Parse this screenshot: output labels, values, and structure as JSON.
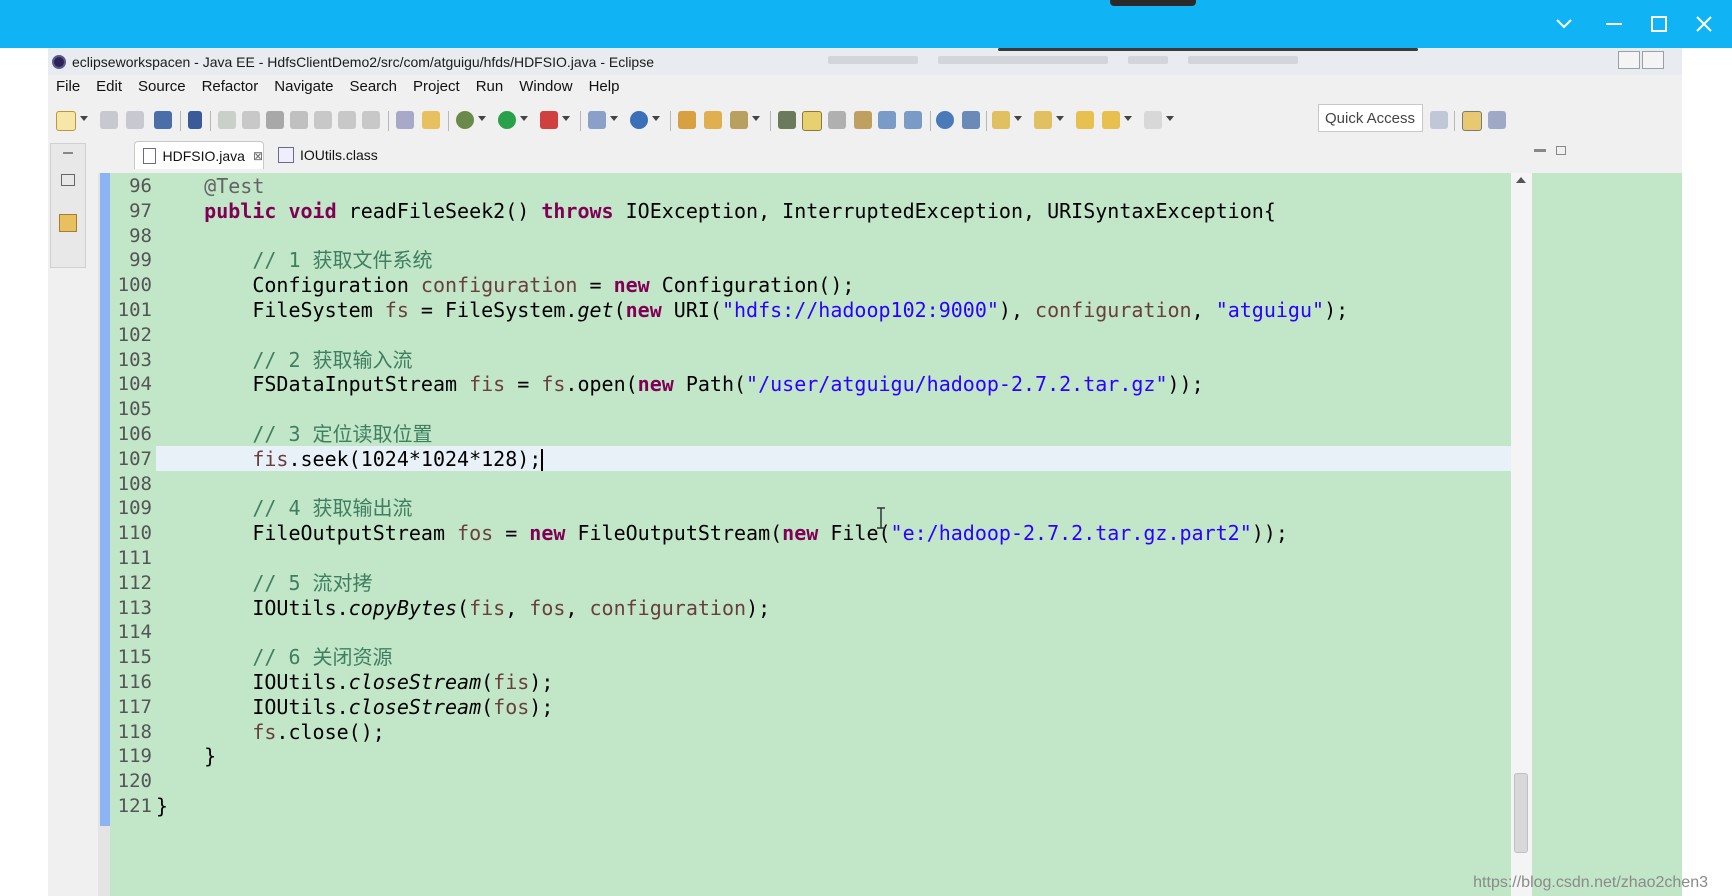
{
  "outer": {
    "title_bar_color": "#10b4f4"
  },
  "window": {
    "title": "eclipseworkspacen - Java EE - HdfsClientDemo2/src/com/atguigu/hfds/HDFSIO.java - Eclipse"
  },
  "menu": [
    "File",
    "Edit",
    "Source",
    "Refactor",
    "Navigate",
    "Search",
    "Project",
    "Run",
    "Window",
    "Help"
  ],
  "quick_access": "Quick Access",
  "tabs": [
    {
      "label": "HDFSIO.java",
      "active": true
    },
    {
      "label": "IOUtils.class",
      "active": false
    }
  ],
  "editor": {
    "lines": [
      {
        "n": "96",
        "code": [
          {
            "t": "    "
          },
          {
            "t": "@Test",
            "c": "ann"
          }
        ]
      },
      {
        "n": "97",
        "code": [
          {
            "t": "    "
          },
          {
            "t": "public",
            "c": "kw"
          },
          {
            "t": " "
          },
          {
            "t": "void",
            "c": "kw"
          },
          {
            "t": " readFileSeek2() "
          },
          {
            "t": "throws",
            "c": "kw"
          },
          {
            "t": " IOException, InterruptedException, URISyntaxException{"
          }
        ]
      },
      {
        "n": "98",
        "code": []
      },
      {
        "n": "99",
        "code": [
          {
            "t": "        "
          },
          {
            "t": "// 1 获取文件系统",
            "c": "cm"
          }
        ]
      },
      {
        "n": "100",
        "code": [
          {
            "t": "        Configuration "
          },
          {
            "t": "configuration",
            "c": "var"
          },
          {
            "t": " = "
          },
          {
            "t": "new",
            "c": "kw"
          },
          {
            "t": " Configuration();"
          }
        ]
      },
      {
        "n": "101",
        "code": [
          {
            "t": "        FileSystem "
          },
          {
            "t": "fs",
            "c": "var"
          },
          {
            "t": " = FileSystem."
          },
          {
            "t": "get",
            "c": "st"
          },
          {
            "t": "("
          },
          {
            "t": "new",
            "c": "kw"
          },
          {
            "t": " URI("
          },
          {
            "t": "\"hdfs://hadoop102:9000\"",
            "c": "str"
          },
          {
            "t": "), "
          },
          {
            "t": "configuration",
            "c": "var"
          },
          {
            "t": ", "
          },
          {
            "t": "\"atguigu\"",
            "c": "str"
          },
          {
            "t": ");"
          }
        ]
      },
      {
        "n": "102",
        "code": []
      },
      {
        "n": "103",
        "code": [
          {
            "t": "        "
          },
          {
            "t": "// 2 获取输入流",
            "c": "cm"
          }
        ]
      },
      {
        "n": "104",
        "code": [
          {
            "t": "        FSDataInputStream "
          },
          {
            "t": "fis",
            "c": "var"
          },
          {
            "t": " = "
          },
          {
            "t": "fs",
            "c": "var"
          },
          {
            "t": ".open("
          },
          {
            "t": "new",
            "c": "kw"
          },
          {
            "t": " Path("
          },
          {
            "t": "\"/user/atguigu/hadoop-2.7.2.tar.gz\"",
            "c": "str"
          },
          {
            "t": "));"
          }
        ]
      },
      {
        "n": "105",
        "code": []
      },
      {
        "n": "106",
        "code": [
          {
            "t": "        "
          },
          {
            "t": "// 3 定位读取位置",
            "c": "cm"
          }
        ]
      },
      {
        "n": "107",
        "code": [
          {
            "t": "        "
          },
          {
            "t": "fis",
            "c": "var"
          },
          {
            "t": ".seek(1024*1024*128);"
          }
        ],
        "current": true
      },
      {
        "n": "108",
        "code": []
      },
      {
        "n": "109",
        "code": [
          {
            "t": "        "
          },
          {
            "t": "// 4 获取输出流",
            "c": "cm"
          }
        ]
      },
      {
        "n": "110",
        "code": [
          {
            "t": "        FileOutputStream "
          },
          {
            "t": "fos",
            "c": "var"
          },
          {
            "t": " = "
          },
          {
            "t": "new",
            "c": "kw"
          },
          {
            "t": " FileOutputStream("
          },
          {
            "t": "new",
            "c": "kw"
          },
          {
            "t": " File("
          },
          {
            "t": "\"e:/hadoop-2.7.2.tar.gz.part2\"",
            "c": "str"
          },
          {
            "t": "));"
          }
        ]
      },
      {
        "n": "111",
        "code": []
      },
      {
        "n": "112",
        "code": [
          {
            "t": "        "
          },
          {
            "t": "// 5 流对拷",
            "c": "cm"
          }
        ]
      },
      {
        "n": "113",
        "code": [
          {
            "t": "        IOUtils."
          },
          {
            "t": "copyBytes",
            "c": "st"
          },
          {
            "t": "("
          },
          {
            "t": "fis",
            "c": "var"
          },
          {
            "t": ", "
          },
          {
            "t": "fos",
            "c": "var"
          },
          {
            "t": ", "
          },
          {
            "t": "configuration",
            "c": "var"
          },
          {
            "t": ");"
          }
        ]
      },
      {
        "n": "114",
        "code": []
      },
      {
        "n": "115",
        "code": [
          {
            "t": "        "
          },
          {
            "t": "// 6 关闭资源",
            "c": "cm"
          }
        ]
      },
      {
        "n": "116",
        "code": [
          {
            "t": "        IOUtils."
          },
          {
            "t": "closeStream",
            "c": "st"
          },
          {
            "t": "("
          },
          {
            "t": "fis",
            "c": "var"
          },
          {
            "t": ");"
          }
        ]
      },
      {
        "n": "117",
        "code": [
          {
            "t": "        IOUtils."
          },
          {
            "t": "closeStream",
            "c": "st"
          },
          {
            "t": "("
          },
          {
            "t": "fos",
            "c": "var"
          },
          {
            "t": ");"
          }
        ]
      },
      {
        "n": "118",
        "code": [
          {
            "t": "        "
          },
          {
            "t": "fs",
            "c": "var"
          },
          {
            "t": ".close();"
          }
        ]
      },
      {
        "n": "119",
        "code": [
          {
            "t": "    }"
          }
        ]
      },
      {
        "n": "120",
        "code": []
      },
      {
        "n": "121",
        "code": [
          {
            "t": "}"
          }
        ]
      }
    ]
  },
  "watermark": "https://blog.csdn.net/zhao2chen3"
}
